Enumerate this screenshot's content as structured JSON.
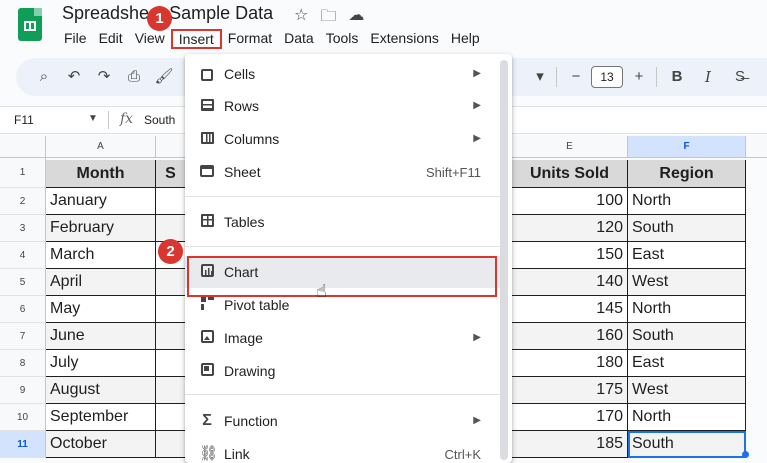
{
  "app": {
    "title": "Spreadsheet Sample Data",
    "title_icons": [
      "star-icon",
      "folder-move-icon",
      "cloud-status-icon"
    ]
  },
  "menubar": [
    "File",
    "Edit",
    "View",
    "Insert",
    "Format",
    "Data",
    "Tools",
    "Extensions",
    "Help"
  ],
  "toolbar": {
    "font_size": "13",
    "minus": "−",
    "plus": "+",
    "bold": "B",
    "italic": "I",
    "strike": "S̶",
    "font_dropdown_arrow": "▾"
  },
  "formula_bar": {
    "cell_ref": "F11",
    "fx_label": "fx",
    "value": "South"
  },
  "columns": [
    "A",
    "E",
    "F"
  ],
  "row_numbers": [
    "1",
    "2",
    "3",
    "4",
    "5",
    "6",
    "7",
    "8",
    "9",
    "10",
    "11"
  ],
  "headers": {
    "month": "Month",
    "units": "Units Sold",
    "region": "Region",
    "col_b_partial": "S"
  },
  "rows": [
    {
      "month": "January",
      "units": "100",
      "region": "North"
    },
    {
      "month": "February",
      "units": "120",
      "region": "South"
    },
    {
      "month": "March",
      "units": "150",
      "region": "East"
    },
    {
      "month": "April",
      "units": "140",
      "region": "West"
    },
    {
      "month": "May",
      "units": "145",
      "region": "North"
    },
    {
      "month": "June",
      "units": "160",
      "region": "South"
    },
    {
      "month": "July",
      "units": "180",
      "region": "East"
    },
    {
      "month": "August",
      "units": "175",
      "region": "West"
    },
    {
      "month": "September",
      "units": "170",
      "region": "North"
    },
    {
      "month": "October",
      "units": "185",
      "region": "South"
    }
  ],
  "insert_menu": {
    "cells": "Cells",
    "rows": "Rows",
    "columns": "Columns",
    "sheet": "Sheet",
    "sheet_shortcut": "Shift+F11",
    "tables": "Tables",
    "chart": "Chart",
    "pivot_table": "Pivot table",
    "image": "Image",
    "drawing": "Drawing",
    "function": "Function",
    "link": "Link",
    "link_shortcut": "Ctrl+K"
  },
  "steps": {
    "one": "1",
    "two": "2"
  },
  "colors": {
    "annotation": "#d9362f",
    "selection": "#1a73e8",
    "brand": "#0f9d58"
  }
}
